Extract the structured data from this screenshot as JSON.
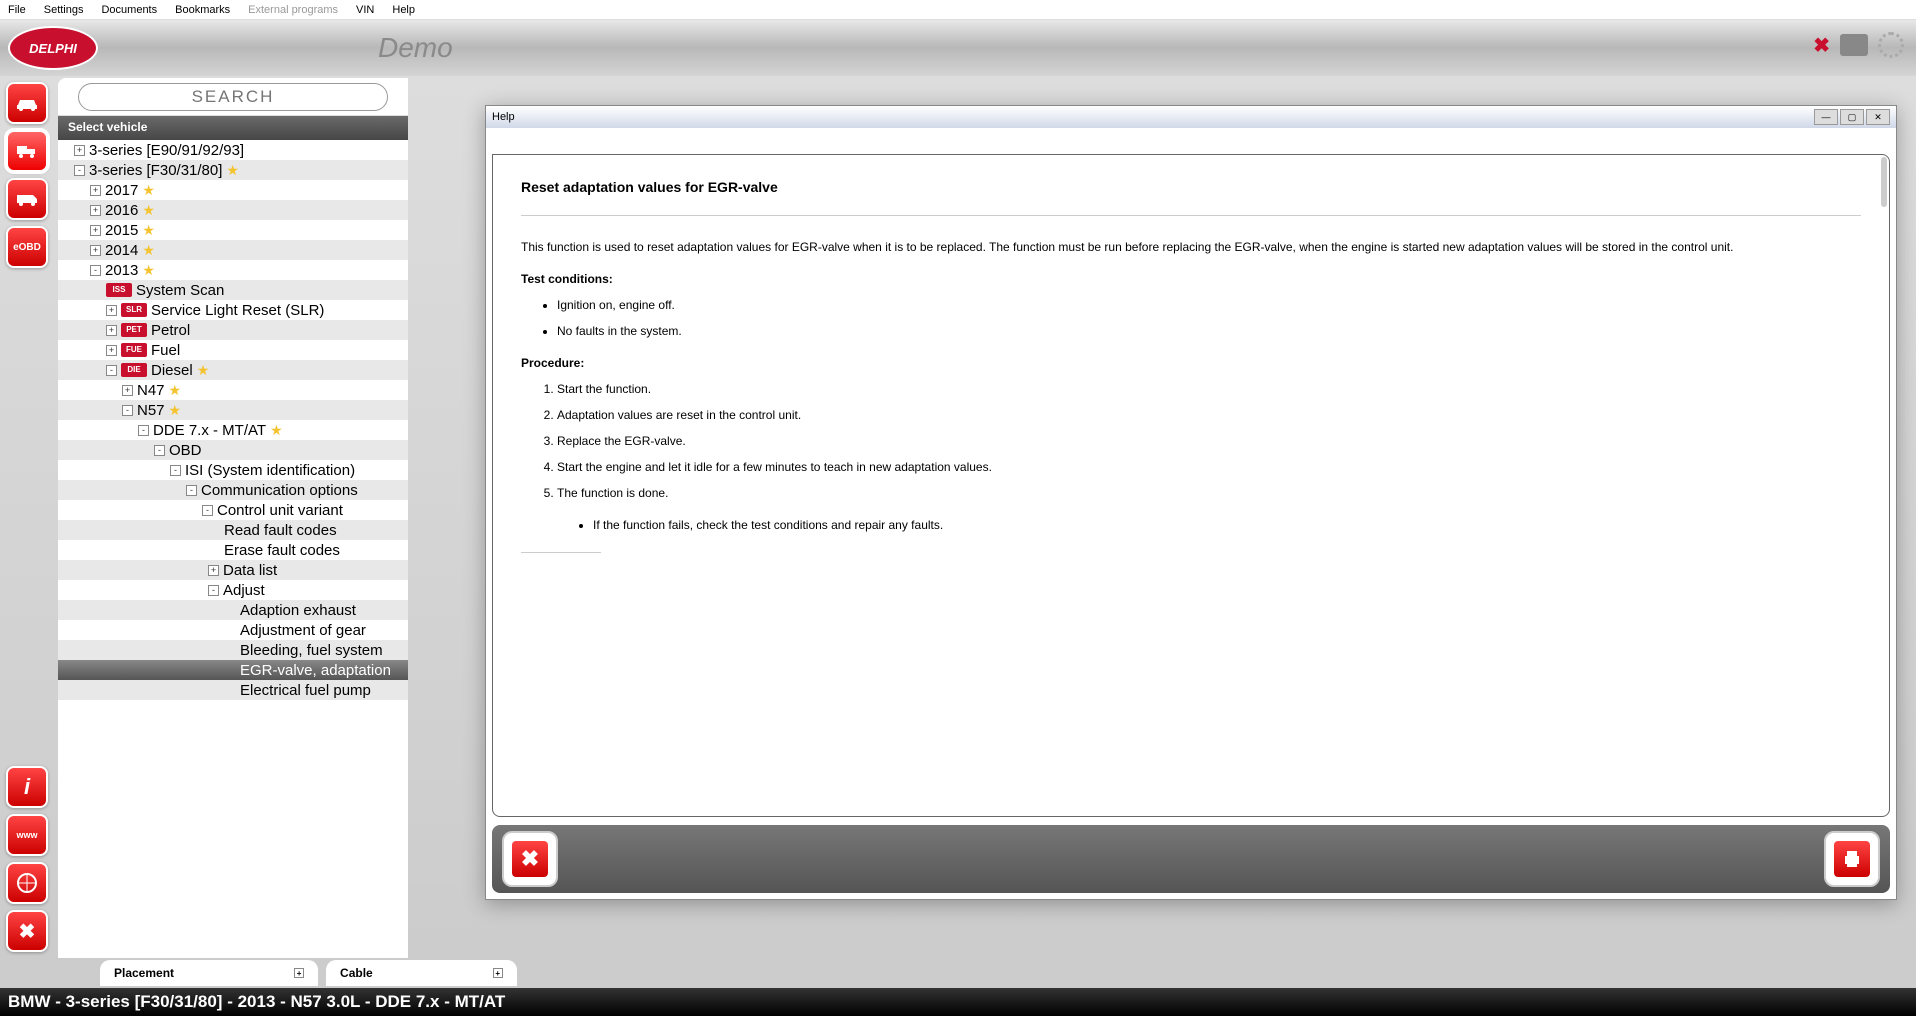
{
  "menubar": [
    "File",
    "Settings",
    "Documents",
    "Bookmarks",
    "External programs",
    "VIN",
    "Help"
  ],
  "menubar_disabled_index": 4,
  "logo_text": "DELPHI",
  "demo_text": "Demo",
  "search_placeholder": "SEARCH",
  "select_vehicle": "Select vehicle",
  "side_icons": [
    "car-icon",
    "truck-icon",
    "van-icon",
    "eobd-icon"
  ],
  "side_bottom": [
    "info-icon",
    "www-icon",
    "compass-icon",
    "close-icon"
  ],
  "tree": [
    {
      "ind": 10,
      "exp": "+",
      "label": "3-series [E90/91/92/93]"
    },
    {
      "ind": 10,
      "exp": "-",
      "label": "3-series [F30/31/80]",
      "star": true
    },
    {
      "ind": 26,
      "exp": "+",
      "label": "2017",
      "star": true
    },
    {
      "ind": 26,
      "exp": "+",
      "label": "2016",
      "star": true
    },
    {
      "ind": 26,
      "exp": "+",
      "label": "2015",
      "star": true
    },
    {
      "ind": 26,
      "exp": "+",
      "label": "2014",
      "star": true
    },
    {
      "ind": 26,
      "exp": "-",
      "label": "2013",
      "star": true
    },
    {
      "ind": 42,
      "icon": "ISS",
      "label": "System Scan"
    },
    {
      "ind": 42,
      "exp": "+",
      "icon": "SLR",
      "label": "Service Light Reset (SLR)"
    },
    {
      "ind": 42,
      "exp": "+",
      "icon": "PET",
      "label": "Petrol"
    },
    {
      "ind": 42,
      "exp": "+",
      "icon": "FUE",
      "label": "Fuel"
    },
    {
      "ind": 42,
      "exp": "-",
      "icon": "DIE",
      "label": "Diesel",
      "star": true
    },
    {
      "ind": 58,
      "exp": "+",
      "label": "N47",
      "star": true
    },
    {
      "ind": 58,
      "exp": "-",
      "label": "N57",
      "star": true
    },
    {
      "ind": 74,
      "exp": "-",
      "label": "DDE 7.x - MT/AT",
      "star": true
    },
    {
      "ind": 90,
      "exp": "-",
      "label": "OBD"
    },
    {
      "ind": 106,
      "exp": "-",
      "label": "ISI (System identification)"
    },
    {
      "ind": 122,
      "exp": "-",
      "label": "Communication options"
    },
    {
      "ind": 138,
      "exp": "-",
      "label": "Control unit variant"
    },
    {
      "ind": 160,
      "label": "Read fault codes"
    },
    {
      "ind": 160,
      "label": "Erase fault codes"
    },
    {
      "ind": 144,
      "exp": "+",
      "label": "Data list"
    },
    {
      "ind": 144,
      "exp": "-",
      "label": "Adjust"
    },
    {
      "ind": 176,
      "label": "Adaption exhaust"
    },
    {
      "ind": 176,
      "label": "Adjustment of gear"
    },
    {
      "ind": 176,
      "label": "Bleeding, fuel system"
    },
    {
      "ind": 176,
      "label": "EGR-valve, adaptation",
      "sel": true
    },
    {
      "ind": 176,
      "label": "Electrical fuel pump"
    }
  ],
  "help": {
    "title": "Help",
    "heading": "Reset adaptation values for EGR-valve",
    "intro": "This function is used to reset adaptation values for EGR-valve when it is to be replaced. The function must be run before replacing the EGR-valve, when the engine is started new adaptation values will be stored in the control unit.",
    "test_cond_title": "Test conditions:",
    "test_cond": [
      "Ignition on, engine off.",
      "No faults in the system."
    ],
    "procedure_title": "Procedure:",
    "procedure": [
      "Start the function.",
      "Adaptation values are reset in the control unit.",
      "Replace the EGR-valve.",
      "Start the engine and let it idle for a few minutes to teach in new adaptation values.",
      "The function is done."
    ],
    "sub_note": "If the function fails, check the test conditions and repair any faults."
  },
  "bottom_tabs": [
    {
      "label": "Placement"
    },
    {
      "label": "Cable"
    }
  ],
  "status": "BMW - 3-series [F30/31/80] - 2013 - N57 3.0L - DDE 7.x - MT/AT"
}
